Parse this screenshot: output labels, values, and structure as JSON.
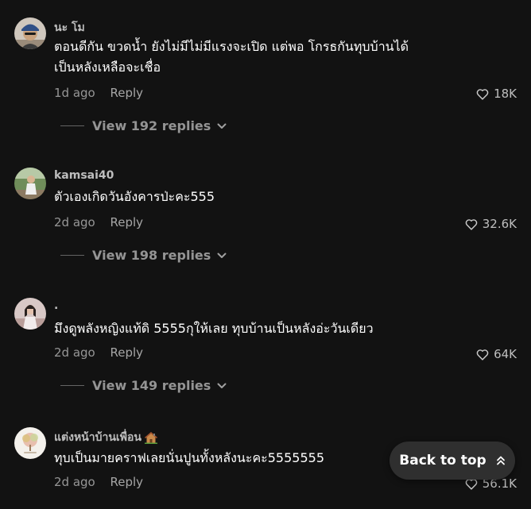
{
  "colors": {
    "background": "#121212",
    "text_primary": "#ffffff",
    "text_secondary": "#8a8a8a",
    "button_bg": "#2f2f2f"
  },
  "comments": [
    {
      "username": "นะ โม",
      "text_lines": [
        "ตอนดีกัน ขวดน้ำ ยังไม่มีไม่มีแรงจะเปิด แต่พอ โกรธกันทุบบ้านได้",
        "เป็นหลังเหลือจะเชื่อ"
      ],
      "time": "1d ago",
      "reply_label": "Reply",
      "likes": "18K",
      "view_replies": "View 192 replies",
      "avatar_icon": "person-cap-avatar"
    },
    {
      "username": "kamsai40",
      "text_lines": [
        "ตัวเองเกิดวันอังคารป่ะคะ555"
      ],
      "time": "2d ago",
      "reply_label": "Reply",
      "likes": "32.6K",
      "view_replies": "View 198 replies",
      "avatar_icon": "person-outdoor-avatar"
    },
    {
      "username": ".",
      "text_lines": [
        "มึงดูพลังหญิงแท้ดิ 5555กุให้เลย ทุบบ้านเป็นหลังอ่ะวันเดียว"
      ],
      "time": "2d ago",
      "reply_label": "Reply",
      "likes": "64K",
      "view_replies": "View 149 replies",
      "avatar_icon": "person-photo-avatar"
    },
    {
      "username": "แต่งหน้าบ้านเพื่อน",
      "username_icon": "house-emoji-icon",
      "text_lines": [
        "ทุบเป็นมายคราฟเลยนั่นปูนทั้งหลังนะคะ5555555"
      ],
      "time": "2d ago",
      "reply_label": "Reply",
      "likes": "56.1K",
      "avatar_icon": "tree-logo-avatar"
    }
  ],
  "back_to_top": {
    "label": "Back to top",
    "icon": "double-chevron-up-icon"
  }
}
